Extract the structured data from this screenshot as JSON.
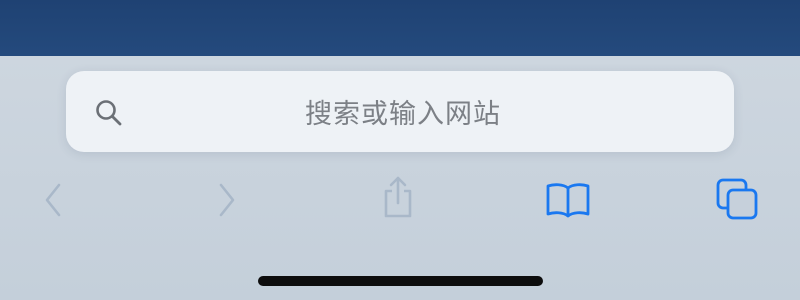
{
  "address_bar": {
    "placeholder": "搜索或输入网站"
  },
  "toolbar": {
    "back": {
      "icon": "chevron-left-icon",
      "enabled": false
    },
    "forward": {
      "icon": "chevron-right-icon",
      "enabled": false
    },
    "share": {
      "icon": "share-icon",
      "enabled": false
    },
    "bookmarks": {
      "icon": "book-icon",
      "enabled": true
    },
    "tabs": {
      "icon": "tabs-icon",
      "enabled": true
    }
  },
  "colors": {
    "page_top": "#1f4273",
    "toolbar_background": "#c6d0db",
    "address_bar_background": "#eef2f6",
    "placeholder_text": "#7c8086",
    "disabled_icon": "#a9b8c9",
    "accent_blue": "#1a78f0",
    "home_indicator": "#0d0d0d"
  }
}
